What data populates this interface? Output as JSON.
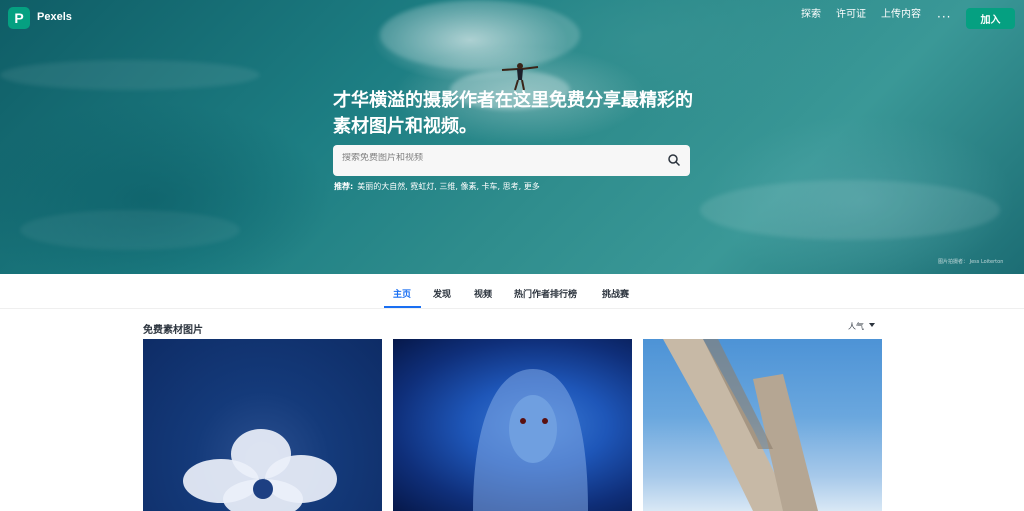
{
  "header": {
    "logo_letter": "P",
    "brand": "Pexels",
    "nav": [
      "探索",
      "许可证",
      "上传内容"
    ],
    "more": "···",
    "join": "加入"
  },
  "hero": {
    "headline": "才华横溢的摄影作者在这里免费分享最精彩的素材图片和视频。",
    "search": {
      "placeholder": "搜索免费图片和视频"
    },
    "suggest_label": "推荐:",
    "suggestions": "美丽的大自然, 霓虹灯, 三维, 像素, 卡车, 思考, 更多",
    "credit": "图片拍摄者：  Jess Loiterton"
  },
  "tabs": [
    "主页",
    "发现",
    "视频",
    "热门作者排行榜",
    "挑战赛"
  ],
  "section": {
    "title": "免费素材图片",
    "sort": "人气"
  },
  "colors": {
    "brand_green": "#05a081",
    "active_blue": "#1a6ff2"
  }
}
